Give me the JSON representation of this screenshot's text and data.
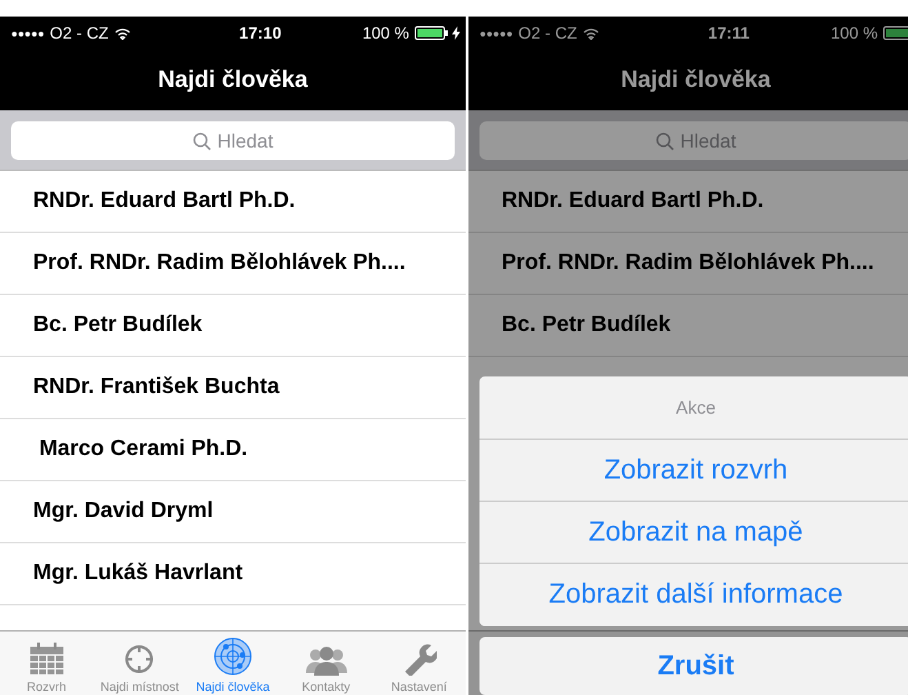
{
  "screens": [
    {
      "status": {
        "signal": "●●●●●",
        "carrier": "O2 - CZ",
        "time": "17:10",
        "battery": "100 %",
        "charging": true
      },
      "title": "Najdi člověka",
      "search": {
        "placeholder": "Hledat"
      },
      "rows": [
        "RNDr. Eduard Bartl Ph.D.",
        "Prof. RNDr. Radim Bělohlávek Ph....",
        "Bc. Petr Budílek",
        "RNDr. František Buchta",
        " Marco Cerami Ph.D.",
        "Mgr. David Dryml",
        "Mgr. Lukáš Havrlant"
      ],
      "tabs": [
        {
          "label": "Rozvrh",
          "selected": false
        },
        {
          "label": "Najdi místnost",
          "selected": false
        },
        {
          "label": "Najdi člověka",
          "selected": true
        },
        {
          "label": "Kontakty",
          "selected": false
        },
        {
          "label": "Nastavení",
          "selected": false
        }
      ]
    },
    {
      "status": {
        "signal": "●●●●●",
        "carrier": "O2 - CZ",
        "time": "17:11",
        "battery": "100 %"
      },
      "title": "Najdi člověka",
      "search": {
        "placeholder": "Hledat"
      },
      "rows": [
        "RNDr. Eduard Bartl Ph.D.",
        "Prof. RNDr. Radim Bělohlávek Ph....",
        "Bc. Petr Budílek"
      ],
      "action_sheet": {
        "title": "Akce",
        "options": [
          "Zobrazit rozvrh",
          "Zobrazit na mapě",
          "Zobrazit další informace"
        ],
        "cancel": "Zrušit"
      }
    }
  ]
}
